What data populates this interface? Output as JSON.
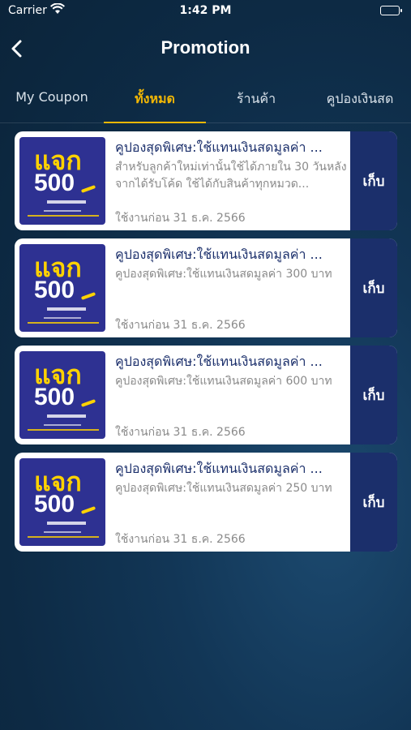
{
  "status": {
    "carrier": "Carrier",
    "time": "1:42 PM"
  },
  "nav": {
    "title": "Promotion"
  },
  "tabs": [
    {
      "label": "My Coupon",
      "active": false
    },
    {
      "label": "ทั้งหมด",
      "active": true
    },
    {
      "label": "ร้านค้า",
      "active": false
    },
    {
      "label": "คูปองเงินสด",
      "active": false
    }
  ],
  "coupons": [
    {
      "title": "คูปองสุดพิเศษ:ใช้แทนเงินสดมูลค่า ...",
      "description": "สำหรับลูกค้าใหม่เท่านั้นใช้ได้ภายใน 30 วันหลังจากได้รับโค้ด ใช้ได้กับสินค้าทุกหมวด...",
      "expiry": "ใช้งานก่อน 31 ธ.ค. 2566",
      "button": "เก็บ",
      "image_text_1": "แจก",
      "image_text_2": "500"
    },
    {
      "title": "คูปองสุดพิเศษ:ใช้แทนเงินสดมูลค่า ...",
      "description": "คูปองสุดพิเศษ:ใช้แทนเงินสดมูลค่า 300 บาท",
      "expiry": "ใช้งานก่อน 31 ธ.ค. 2566",
      "button": "เก็บ",
      "image_text_1": "แจก",
      "image_text_2": "500"
    },
    {
      "title": "คูปองสุดพิเศษ:ใช้แทนเงินสดมูลค่า ...",
      "description": "คูปองสุดพิเศษ:ใช้แทนเงินสดมูลค่า 600 บาท",
      "expiry": "ใช้งานก่อน 31 ธ.ค. 2566",
      "button": "เก็บ",
      "image_text_1": "แจก",
      "image_text_2": "500"
    },
    {
      "title": "คูปองสุดพิเศษ:ใช้แทนเงินสดมูลค่า ...",
      "description": "คูปองสุดพิเศษ:ใช้แทนเงินสดมูลค่า 250 บาท",
      "expiry": "ใช้งานก่อน 31 ธ.ค. 2566",
      "button": "เก็บ",
      "image_text_1": "แจก",
      "image_text_2": "500"
    }
  ],
  "colors": {
    "accent": "#f2b705",
    "brand": "#1b2f6b",
    "coupon_bg": "#2e3192"
  }
}
